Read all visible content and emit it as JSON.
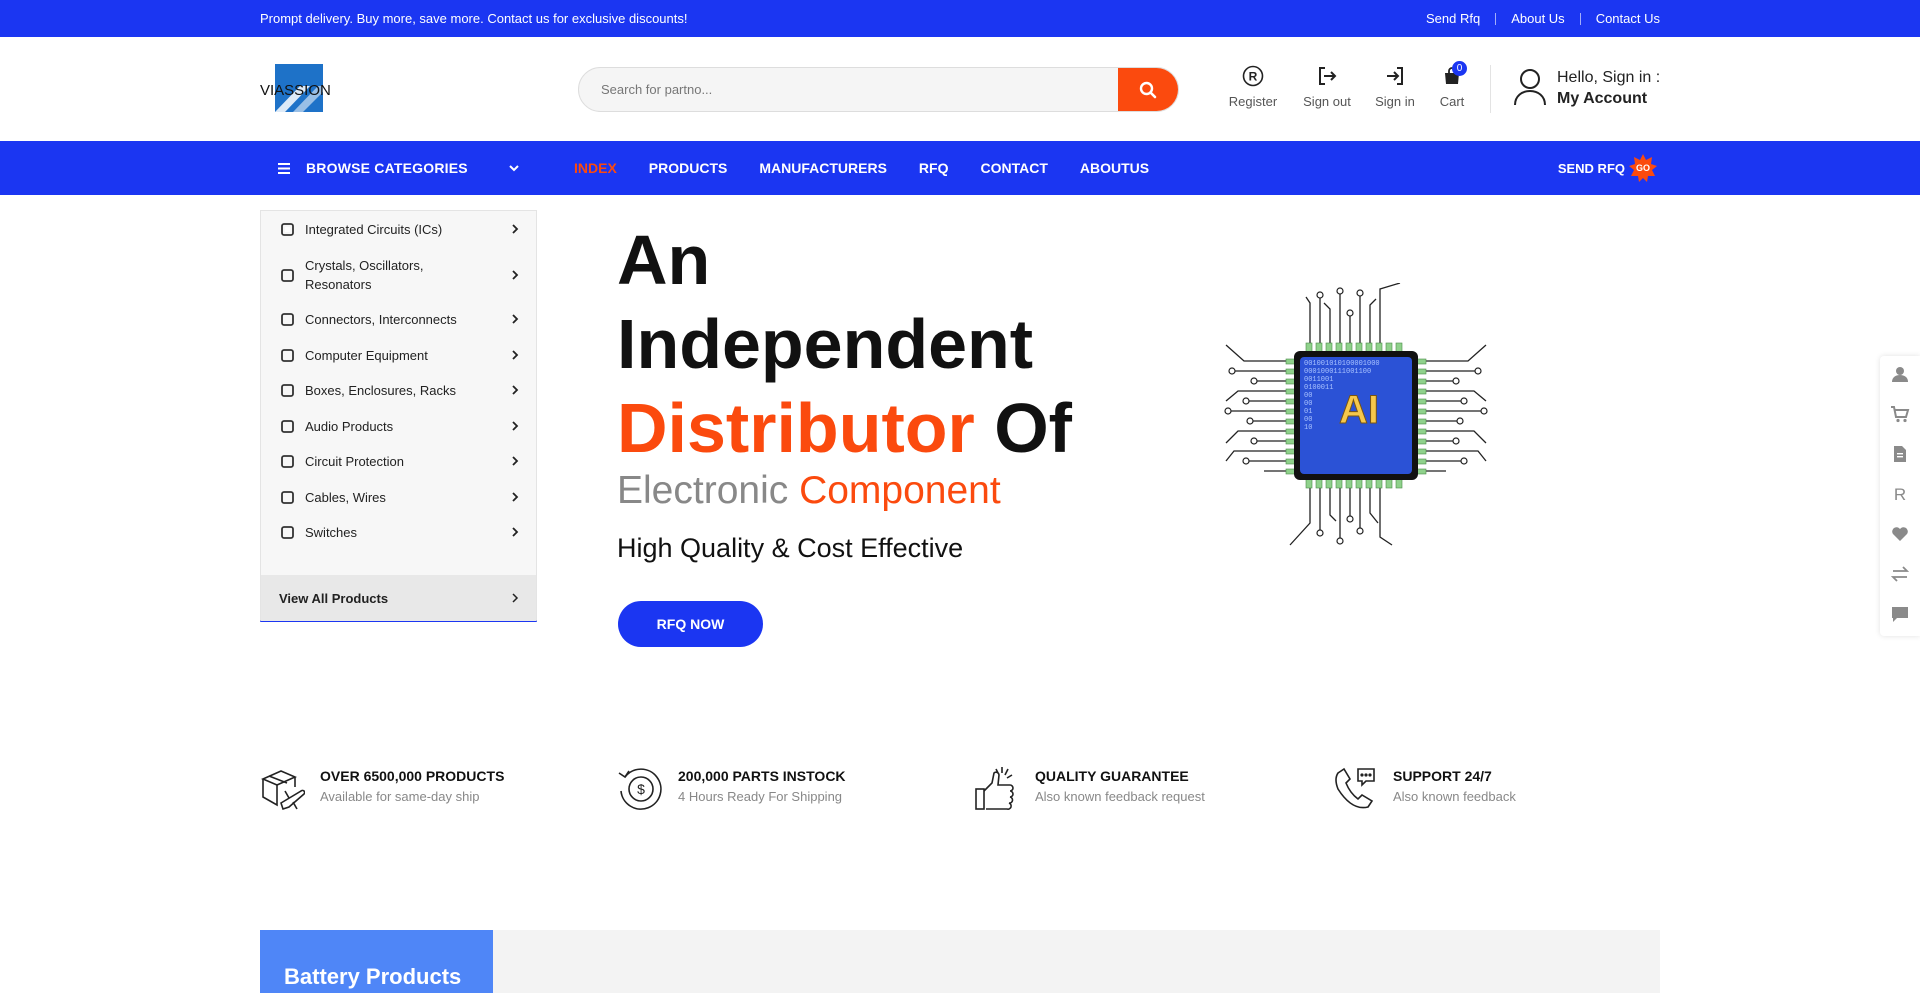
{
  "topbar": {
    "promo": "Prompt delivery. Buy more, save more. Contact us for exclusive discounts!",
    "links": [
      "Send Rfq",
      "About Us",
      "Contact Us"
    ]
  },
  "header": {
    "logo_text": "VIASSION",
    "search_placeholder": "Search for partno...",
    "icons": {
      "register": "Register",
      "signout": "Sign out",
      "signin": "Sign in",
      "cart": "Cart",
      "cart_count": "0"
    },
    "account": {
      "hello": "Hello, Sign in :",
      "my_account": "My Account"
    }
  },
  "nav": {
    "browse": "BROWSE CATEGORIES",
    "items": [
      "INDEX",
      "PRODUCTS",
      "MANUFACTURERS",
      "RFQ",
      "CONTACT",
      "ABOUTUS"
    ],
    "active": "INDEX",
    "send_rfq": "SEND RFQ",
    "go": "GO"
  },
  "categories": {
    "items": [
      "Integrated Circuits (ICs)",
      "Crystals, Oscillators, Resonators",
      "Connectors, Interconnects",
      "Computer Equipment",
      "Boxes, Enclosures, Racks",
      "Audio Products",
      "Circuit Protection",
      "Cables, Wires",
      "Switches"
    ],
    "view_all": "View All Products"
  },
  "hero": {
    "line1": "An",
    "line2": "Independent",
    "line3_orange": "Distributor",
    "line3_black": "Of",
    "sub_gray": "Electronic",
    "sub_orange": "Component",
    "tagline": "High Quality & Cost Effective",
    "cta": "RFQ NOW",
    "chip_label": "AI",
    "chip_code": [
      "001001010100001000",
      "0001000111001100",
      "0011001",
      "0100011",
      "00",
      "00",
      "01",
      "00",
      "10"
    ]
  },
  "features": [
    {
      "title": "OVER 6500,000 PRODUCTS",
      "sub": "Available for same-day ship",
      "icon": "box-plane-icon"
    },
    {
      "title": "200,000 PARTS INSTOCK",
      "sub": "4 Hours Ready For Shipping",
      "icon": "dollar-cycle-icon"
    },
    {
      "title": "QUALITY GUARANTEE",
      "sub": "Also known feedback request",
      "icon": "thumbs-up-icon"
    },
    {
      "title": "SUPPORT 24/7",
      "sub": "Also known feedback",
      "icon": "phone-chat-icon"
    }
  ],
  "sections": {
    "battery": "Battery Products"
  },
  "colors": {
    "brand_blue": "#1b36f2",
    "accent_orange": "#fb4a0e",
    "light_blue": "#4f86f7"
  }
}
